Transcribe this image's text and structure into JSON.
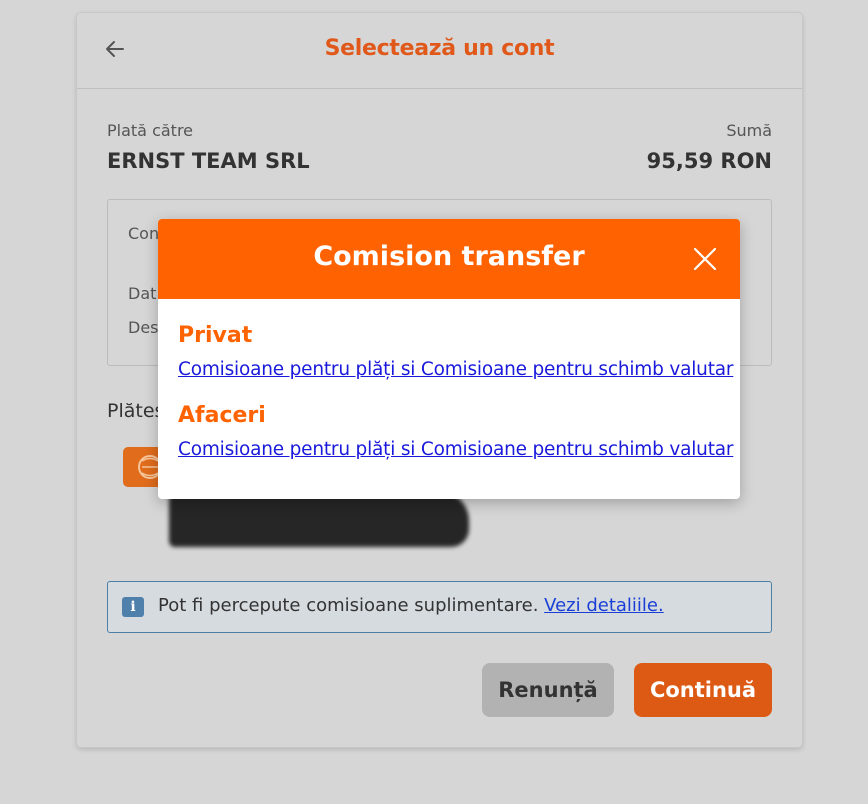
{
  "header": {
    "title": "Selectează un cont"
  },
  "payment": {
    "to_label": "Plată către",
    "to_value": "ERNST TEAM SRL",
    "amount_label": "Sumă",
    "amount_value": "95,59 RON"
  },
  "details": {
    "row1_label": "Con",
    "row2_label": "Dat",
    "row3_label": "Des"
  },
  "pay_from_label": "Plăteș",
  "info": {
    "text": "Pot fi percepute comisioane suplimentare.",
    "link": "Vezi detaliile."
  },
  "buttons": {
    "cancel": "Renunță",
    "continue": "Continuă"
  },
  "modal": {
    "title": "Comision transfer",
    "sections": [
      {
        "title": "Privat",
        "link": "Comisioane pentru plăți si Comisioane pentru schimb valutar"
      },
      {
        "title": "Afaceri",
        "link": "Comisioane pentru plăți si Comisioane pentru schimb valutar"
      }
    ]
  },
  "colors": {
    "brand_orange": "#ff6200",
    "title_orange": "#e0591a",
    "link_blue": "#1a1adc",
    "info_blue": "#4f7fab"
  },
  "icons": [
    "arrow-left-icon",
    "close-icon",
    "info-icon",
    "bank-logo-icon"
  ]
}
